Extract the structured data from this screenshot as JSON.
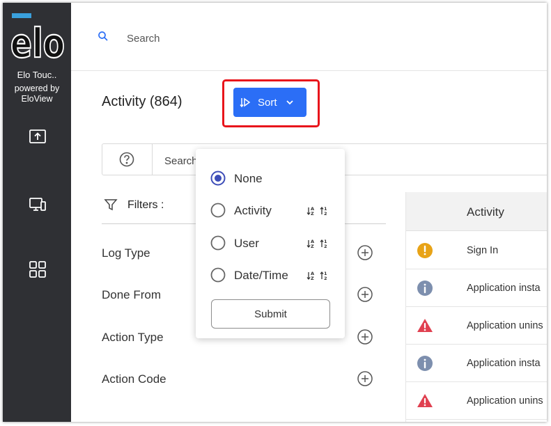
{
  "sidebar": {
    "logo_text": "elo",
    "brand_title": "Elo Touc..",
    "brand_sub_line1": "powered by",
    "brand_sub_line2": "EloView",
    "nav": [
      {
        "icon": "upload-icon"
      },
      {
        "icon": "devices-icon"
      },
      {
        "icon": "apps-grid-icon"
      }
    ]
  },
  "header": {
    "search_placeholder": "Search"
  },
  "page": {
    "title": "Activity (864)",
    "sort_label": "Sort",
    "search_placeholder": "Search"
  },
  "filters": {
    "label": "Filters :",
    "items": [
      "Log Type",
      "Done From",
      "Action Type",
      "Action Code"
    ]
  },
  "table": {
    "header": "Activity",
    "rows": [
      {
        "icon": "warning-circle-icon",
        "color": "#e8a317",
        "text": "Sign In"
      },
      {
        "icon": "info-icon",
        "color": "#7d8fae",
        "text": "Application insta"
      },
      {
        "icon": "alert-triangle-icon",
        "color": "#e04050",
        "text": "Application unins"
      },
      {
        "icon": "info-icon",
        "color": "#7d8fae",
        "text": "Application insta"
      },
      {
        "icon": "alert-triangle-icon",
        "color": "#e04050",
        "text": "Application unins"
      }
    ]
  },
  "sort_menu": {
    "options": [
      {
        "label": "None",
        "selected": true
      },
      {
        "label": "Activity",
        "selected": false
      },
      {
        "label": "User",
        "selected": false
      },
      {
        "label": "Date/Time",
        "selected": false
      }
    ],
    "submit_label": "Submit"
  },
  "colors": {
    "sidebar_bg": "#2f3034",
    "accent": "#2b6ef6",
    "highlight": "#e8141b",
    "radio_selected": "#3d4db8"
  }
}
